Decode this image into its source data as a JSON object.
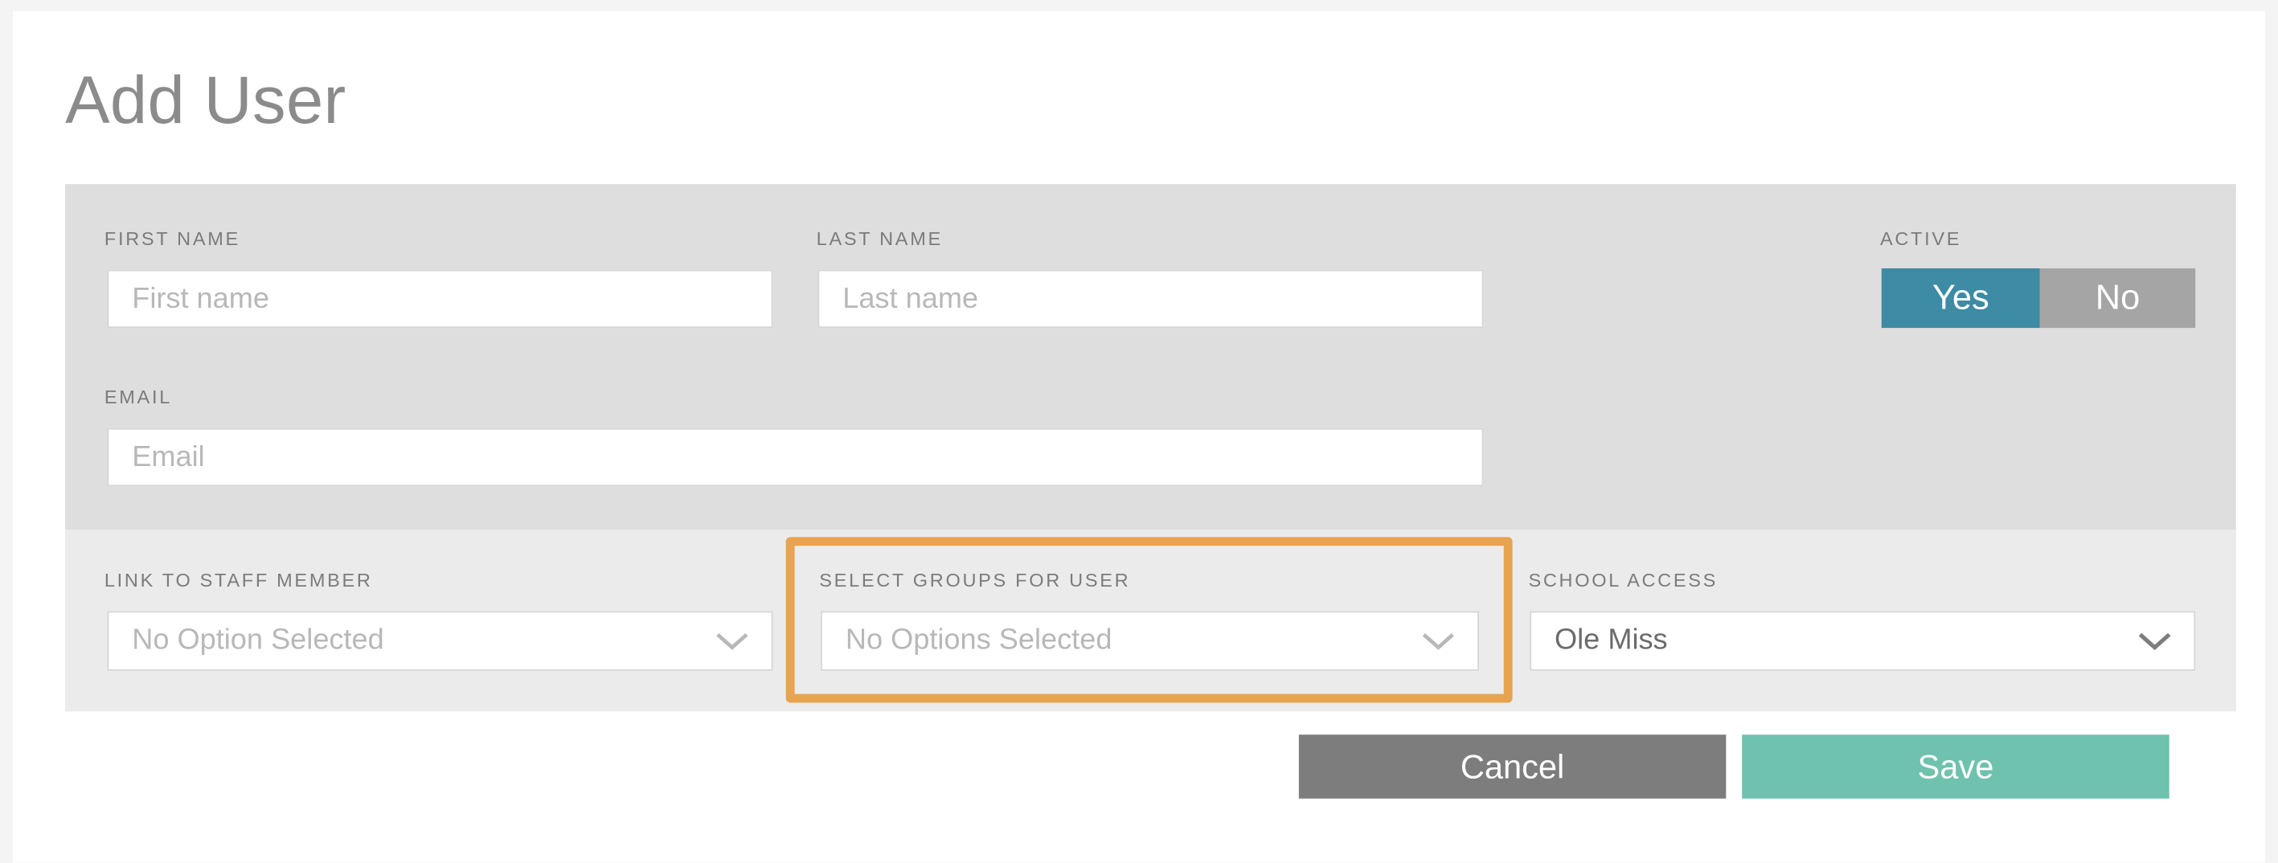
{
  "page": {
    "title": "Add User"
  },
  "quick_save": {
    "icon": "floppy-disk-save-icon",
    "color": "#6ec2ae"
  },
  "form": {
    "first_name": {
      "label": "FIRST NAME",
      "placeholder": "First name",
      "value": ""
    },
    "last_name": {
      "label": "LAST NAME",
      "placeholder": "Last name",
      "value": ""
    },
    "active": {
      "label": "ACTIVE",
      "yes_label": "Yes",
      "no_label": "No",
      "selected": "Yes",
      "on_color": "#3d8ba4",
      "off_color": "#a5a5a5"
    },
    "email": {
      "label": "EMAIL",
      "placeholder": "Email",
      "value": ""
    },
    "link_to_staff_member": {
      "label": "LINK TO STAFF MEMBER",
      "value": "No Option Selected",
      "icon": "chevron-down-icon"
    },
    "select_groups_for_user": {
      "label": "SELECT GROUPS FOR USER",
      "value": "No Options Selected",
      "icon": "chevron-down-icon",
      "highlighted": true,
      "highlight_color": "#e8a34e"
    },
    "school_access": {
      "label": "SCHOOL ACCESS",
      "value": "Ole Miss",
      "icon": "chevron-down-icon"
    }
  },
  "footer": {
    "cancel_label": "Cancel",
    "save_label": "Save",
    "cancel_color": "#7d7d7d",
    "save_color": "#6ec2ae"
  }
}
